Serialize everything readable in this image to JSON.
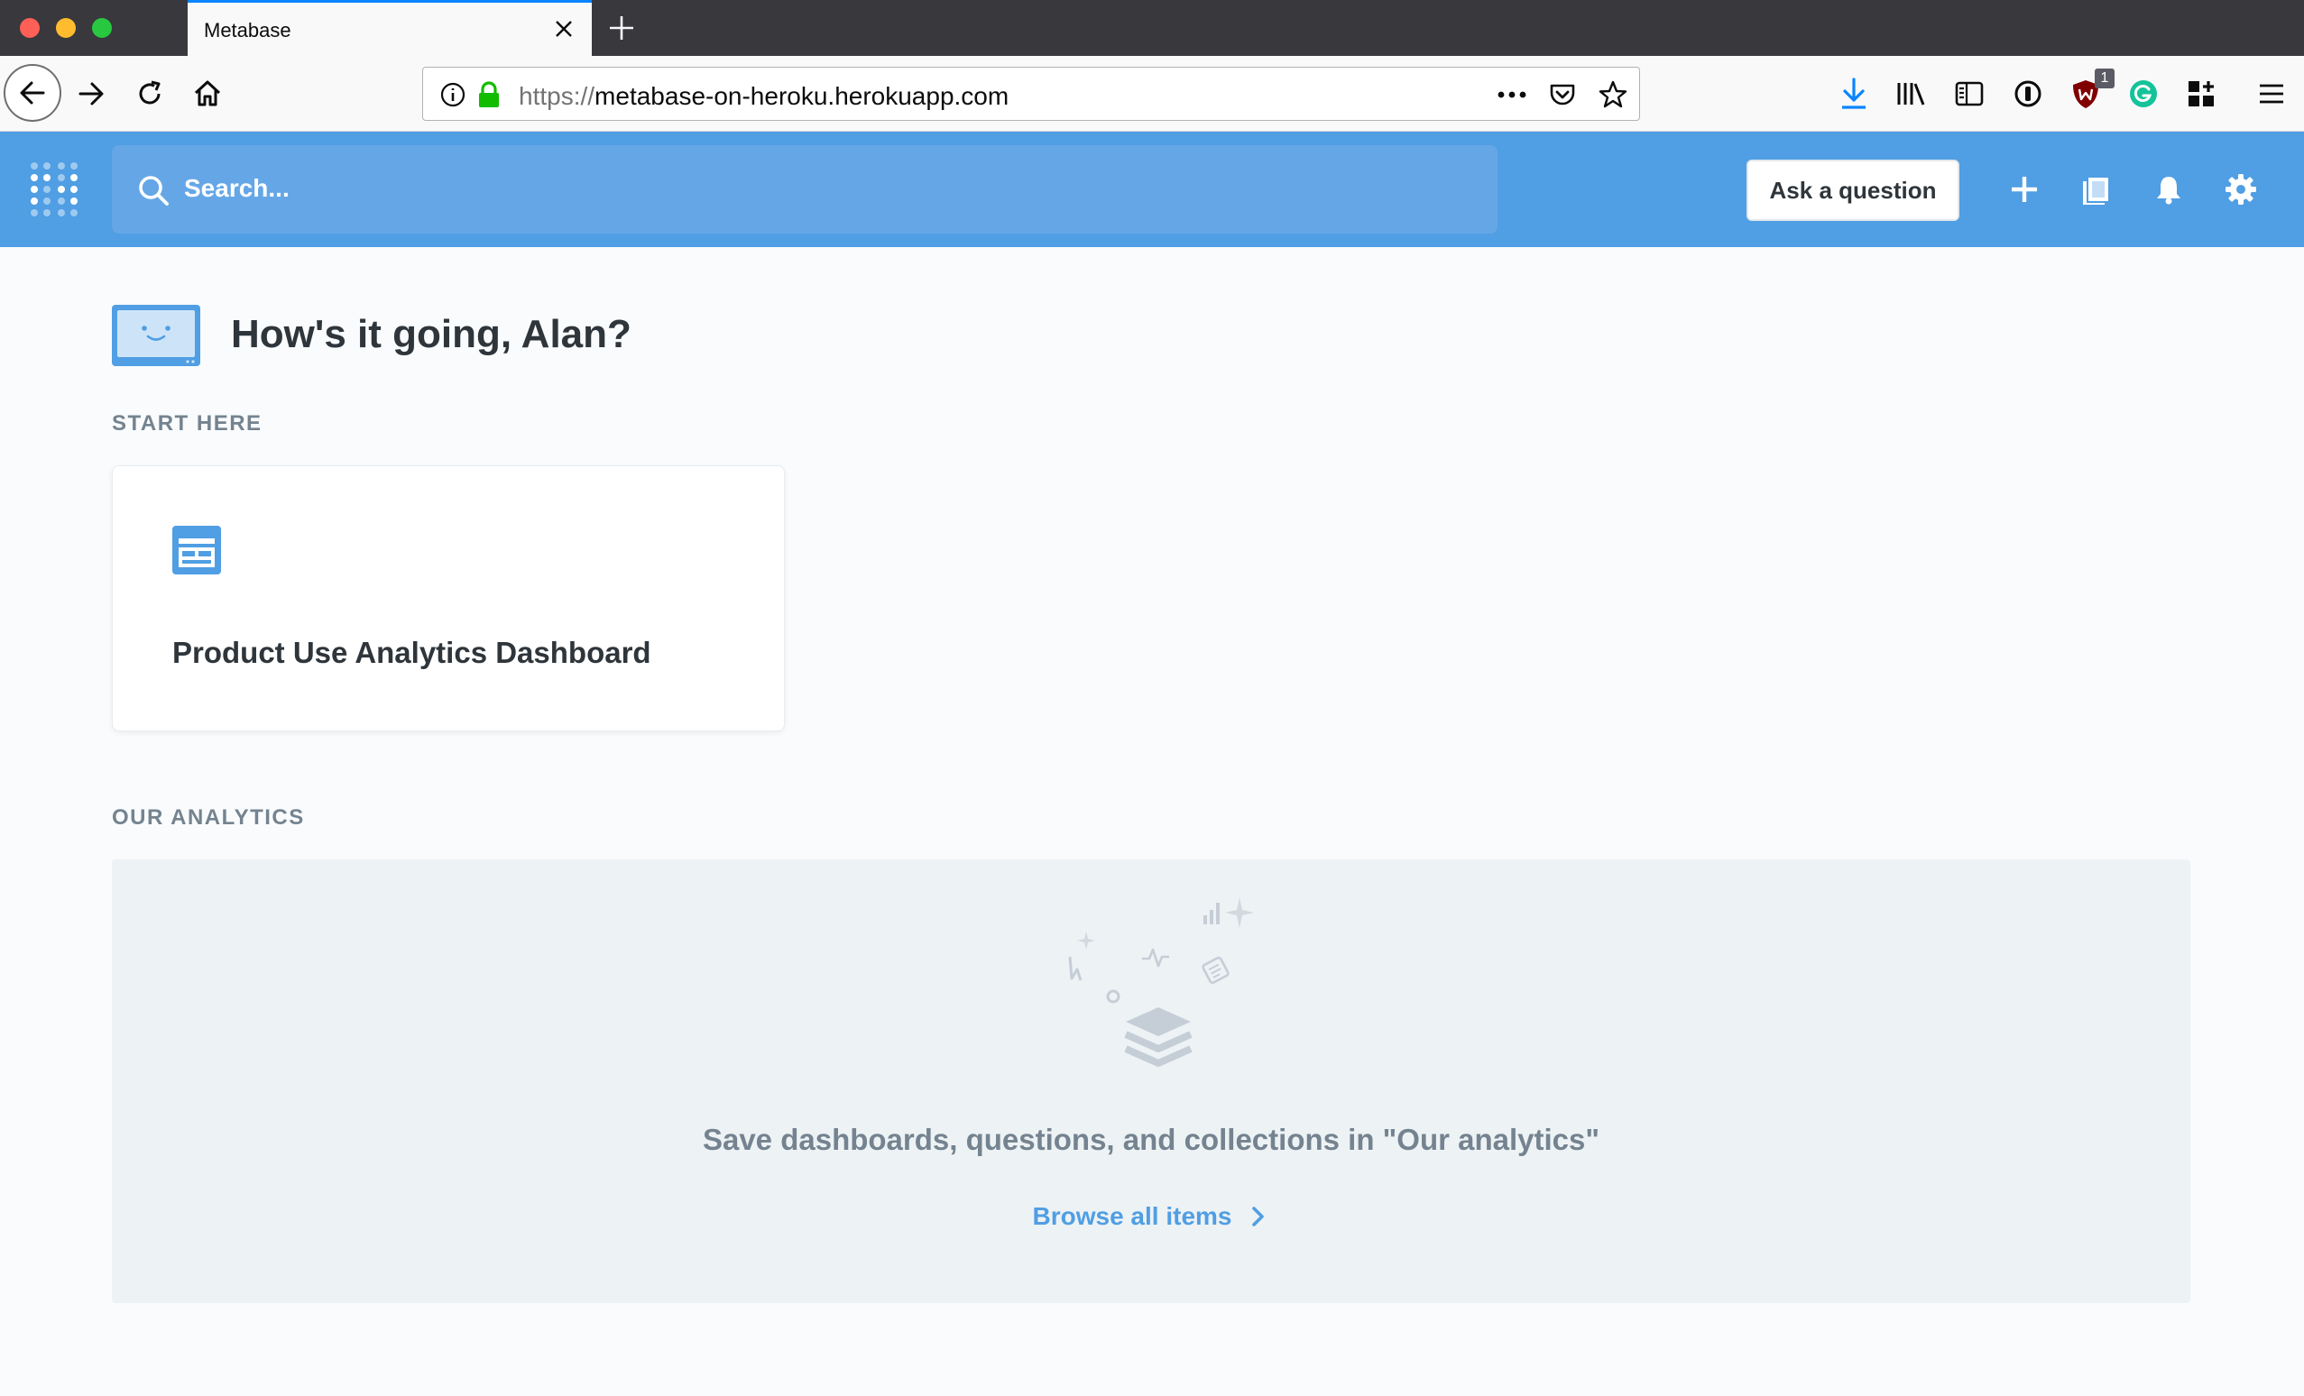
{
  "browser": {
    "tab_title": "Metabase",
    "url_scheme": "https://",
    "url_host": "metabase-on-heroku.herokuapp.com",
    "extension_badge": "1"
  },
  "nav": {
    "search_placeholder": "Search...",
    "ask_button": "Ask a question",
    "brand_color": "#509ee3"
  },
  "main": {
    "greeting": "How's it going, Alan?",
    "start_here_label": "START HERE",
    "start_card_title": "Product Use Analytics Dashboard",
    "our_analytics_label": "OUR ANALYTICS",
    "empty_message": "Save dashboards, questions, and collections in \"Our analytics\"",
    "browse_link": "Browse all items"
  }
}
